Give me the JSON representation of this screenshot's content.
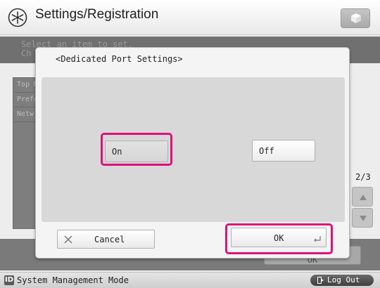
{
  "header": {
    "title": "Settings/Registration",
    "settings_icon": "settings-registration-icon",
    "cube_icon": "cube-icon"
  },
  "background": {
    "hint_line1": "Select an item to set.",
    "hint_line2": "Ch",
    "list_rows": [
      "Top M",
      "Prefe",
      "Netw"
    ],
    "page_indicator": "2/3",
    "bottom_ok_label": "OK"
  },
  "dialog": {
    "title": "<Dedicated Port Settings>",
    "options": {
      "on_label": "On",
      "off_label": "Off",
      "selected": "On"
    },
    "cancel_label": "Cancel",
    "ok_label": "OK"
  },
  "status_bar": {
    "mode_icon_label": "ID",
    "mode_text": "System Management Mode",
    "logout_label": "Log Out"
  },
  "colors": {
    "highlight": "#e0107a"
  }
}
